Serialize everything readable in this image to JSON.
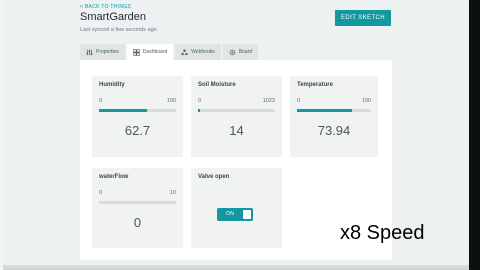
{
  "header": {
    "back_label": "< BACK TO THINGS",
    "title": "SmartGarden",
    "subtitle": "Last synced a few seconds ago",
    "edit_label": "EDIT SKETCH"
  },
  "tabs": [
    {
      "label": "Properties",
      "icon": "sliders-icon"
    },
    {
      "label": "Dashboard",
      "icon": "dashboard-icon"
    },
    {
      "label": "Webhooks",
      "icon": "webhooks-icon"
    },
    {
      "label": "Board",
      "icon": "gear-icon"
    }
  ],
  "active_tab": "Dashboard",
  "widgets": [
    {
      "title": "Humidity",
      "min": "0",
      "max": "100",
      "value": "62.7",
      "fraction": 0.627
    },
    {
      "title": "Soil Moisture",
      "min": "0",
      "max": "1023",
      "value": "14",
      "fraction": 0.0137
    },
    {
      "title": "Temperature",
      "min": "0",
      "max": "100",
      "value": "73.94",
      "fraction": 0.7394
    },
    {
      "title": "waterFlow",
      "min": "0",
      "max": "10",
      "value": "0",
      "fraction": 0
    }
  ],
  "switch": {
    "title": "Valve open",
    "state_label": "ON",
    "on": true
  },
  "overlay": {
    "speed_label": "x8 Speed"
  },
  "colors": {
    "accent": "#12989e",
    "card": "#f1f3f3",
    "text": "#434f54"
  }
}
